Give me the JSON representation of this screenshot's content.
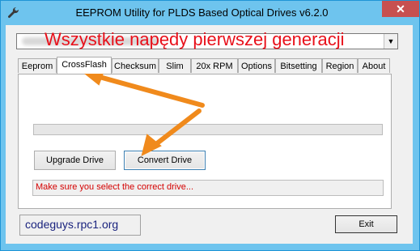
{
  "window": {
    "title": "EEPROM Utility for PLDS Based Optical Drives v6.2.0",
    "close_glyph": "✕"
  },
  "icons": {
    "app": "wrench-icon",
    "close": "close-icon",
    "dropdown": "chevron-down-icon"
  },
  "drive_select": {
    "arrow_glyph": "▼"
  },
  "overlay": {
    "text": "Wszystkie napędy pierwszej generacji",
    "color": "#e8101a",
    "arrow_color": "#f08a1c"
  },
  "tabs": [
    {
      "label": "Eeprom",
      "active": false
    },
    {
      "label": "CrossFlash",
      "active": true
    },
    {
      "label": "Checksum",
      "active": false
    },
    {
      "label": "Slim",
      "active": false
    },
    {
      "label": "20x RPM",
      "active": false
    },
    {
      "label": "Options",
      "active": false
    },
    {
      "label": "Bitsetting",
      "active": false
    },
    {
      "label": "Region",
      "active": false
    },
    {
      "label": "About",
      "active": false
    }
  ],
  "crossflash": {
    "progress": 0,
    "upgrade_label": "Upgrade Drive",
    "convert_label": "Convert Drive",
    "status_text": "Make sure you select the correct drive..."
  },
  "footer": {
    "site": "codeguys.rpc1.org",
    "exit_label": "Exit"
  }
}
